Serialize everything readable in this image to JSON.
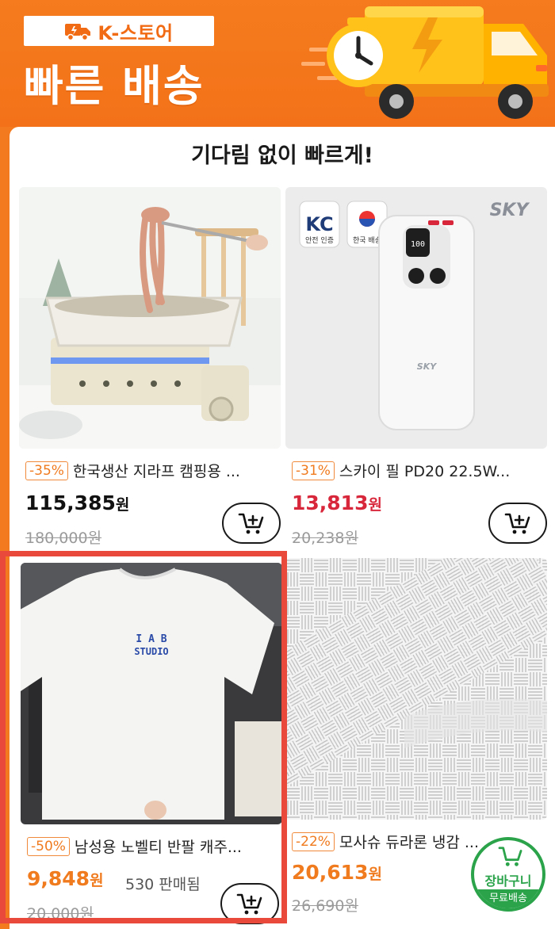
{
  "banner": {
    "store_label": "K-스토어",
    "title": "빠른 배송"
  },
  "section": {
    "title": "기다림 없이 빠르게!"
  },
  "products": [
    {
      "discount": "-35%",
      "name": "한국생산 지라프 캠핑용 ...",
      "price": "115,385",
      "currency": "원",
      "original_price": "180,000원",
      "sold": "",
      "price_color": "#111111"
    },
    {
      "discount": "-31%",
      "name": "스카이 필 PD20 22.5W...",
      "price": "13,813",
      "currency": "원",
      "original_price": "20,238원",
      "sold": "",
      "price_color": "#d8263a",
      "badges": [
        "안전 인증",
        "한국 배송"
      ],
      "brand": "SKY"
    },
    {
      "discount": "-50%",
      "name": "남성용 노벨티 반팔 캐주...",
      "price": "9,848",
      "currency": "원",
      "original_price": "20,000원",
      "sold": "530 판매됨",
      "price_color": "#f07a1e",
      "print_text": [
        "I A B",
        "STUDIO"
      ]
    },
    {
      "discount": "-22%",
      "name": "모사슈 듀라론 냉감 ...",
      "price": "20,613",
      "currency": "원",
      "original_price": "26,690원",
      "sold": "",
      "price_color": "#f07a1e"
    }
  ],
  "floating_cart": {
    "label": "장바구니",
    "free_shipping": "무료배송"
  },
  "colors": {
    "brand_orange": "#f47a1f",
    "highlight_red": "#e8493a",
    "cart_green": "#2aa34a"
  }
}
